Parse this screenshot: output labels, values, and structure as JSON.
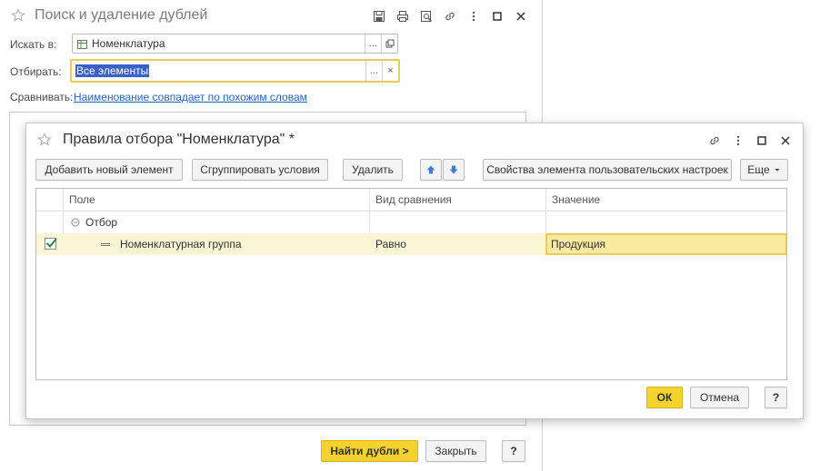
{
  "main": {
    "title": "Поиск и удаление дублей",
    "search_in_label": "Искать в:",
    "search_in_value": "Номенклатура",
    "filter_label": "Отбирать:",
    "filter_value": "Все элементы",
    "compare_label": "Сравнивать:",
    "compare_link": "Наименование совпадает по похожим словам",
    "find_button": "Найти дубли >",
    "close_button": "Закрыть",
    "help_button": "?"
  },
  "dialog": {
    "title": "Правила отбора \"Номенклатура\" *",
    "toolbar": {
      "add": "Добавить новый элемент",
      "group": "Сгруппировать условия",
      "delete": "Удалить",
      "properties": "Свойства элемента пользовательских настроек",
      "more": "Еще"
    },
    "columns": [
      "Поле",
      "Вид сравнения",
      "Значение"
    ],
    "group_row": "Отбор",
    "row": {
      "field": "Номенклатурная группа",
      "comparison": "Равно",
      "value": "Продукция"
    },
    "ok": "ОК",
    "cancel": "Отмена",
    "help": "?"
  },
  "colors": {
    "accent_yellow": "#f5d22e",
    "focus_border": "#e8cd5a",
    "link_blue": "#2c62b8",
    "selection_blue": "#3a61c9",
    "arrow_blue": "#3b7fd6"
  }
}
